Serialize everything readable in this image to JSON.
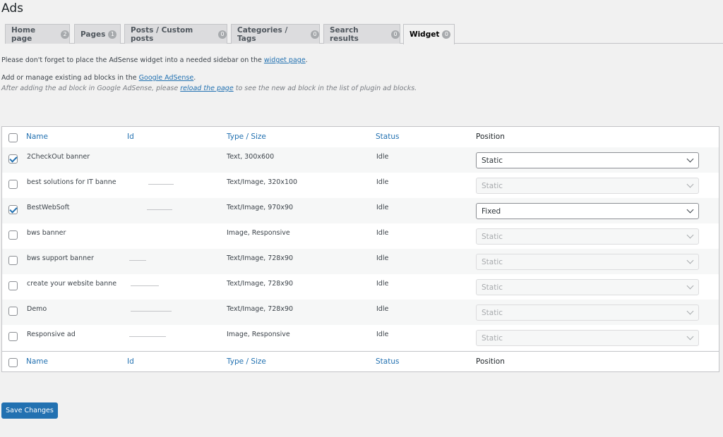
{
  "page": {
    "title": "Ads"
  },
  "tabs": [
    {
      "label": "Home page",
      "count": "2"
    },
    {
      "label": "Pages",
      "count": "1"
    },
    {
      "label": "Posts / Custom posts",
      "count": "0"
    },
    {
      "label": "Categories / Tags",
      "count": "0"
    },
    {
      "label": "Search results",
      "count": "0"
    },
    {
      "label": "Widget",
      "count": "0"
    }
  ],
  "notices": {
    "widget_prefix": "Please don't forget to place the AdSense widget into a needed sidebar on the",
    "widget_link": "widget page",
    "widget_suffix": ".",
    "manage_prefix": "Add or manage existing ad blocks in the",
    "manage_link": "Google AdSense",
    "manage_suffix": ".",
    "after_prefix": "After adding the ad block in Google AdSense, please",
    "after_link": "reload the page",
    "after_suffix": "to see the new ad block in the list of plugin ad blocks."
  },
  "table": {
    "columns": {
      "name": "Name",
      "id": "Id",
      "type": "Type / Size",
      "status": "Status",
      "position": "Position"
    },
    "rows": [
      {
        "name": "2CheckOut banner",
        "type": "Text, 300x600",
        "status": "Idle",
        "position": "Static",
        "checked": true
      },
      {
        "name": "best solutions for IT banne",
        "type": "Text/Image, 320x100",
        "status": "Idle",
        "position": "Static",
        "checked": false
      },
      {
        "name": "BestWebSoft",
        "type": "Text/Image, 970x90",
        "status": "Idle",
        "position": "Fixed",
        "checked": true
      },
      {
        "name": "bws banner",
        "type": "Image, Responsive",
        "status": "Idle",
        "position": "Static",
        "checked": false
      },
      {
        "name": "bws support banner",
        "type": "Text/Image, 728x90",
        "status": "Idle",
        "position": "Static",
        "checked": false
      },
      {
        "name": "create your website banne",
        "type": "Text/Image, 728x90",
        "status": "Idle",
        "position": "Static",
        "checked": false
      },
      {
        "name": "Demo",
        "type": "Text/Image, 728x90",
        "status": "Idle",
        "position": "Static",
        "checked": false
      },
      {
        "name": "Responsive ad",
        "type": "Image, Responsive",
        "status": "Idle",
        "position": "Static",
        "checked": false
      }
    ]
  },
  "actions": {
    "save_label": "Save Changes"
  },
  "colors": {
    "accent": "#2271b1",
    "background": "#f1f1f1"
  }
}
